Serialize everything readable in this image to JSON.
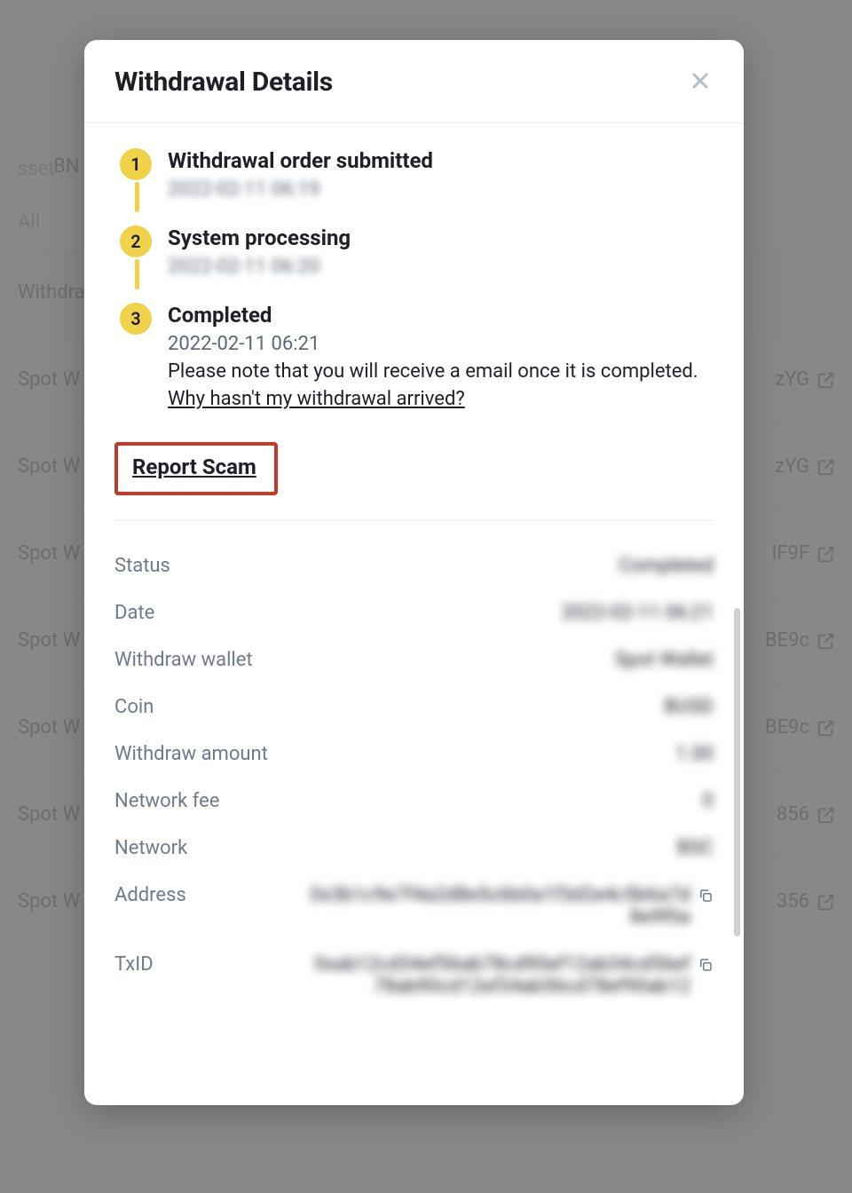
{
  "background": {
    "coin_hint": "BN",
    "column_header": "sset",
    "filter": "All",
    "row_heading": "Withdraw",
    "rows": [
      {
        "left": "Spot W",
        "right": "zYG"
      },
      {
        "left": "Spot W",
        "right": "zYG"
      },
      {
        "left": "Spot W",
        "right": "IF9F"
      },
      {
        "left": "Spot W",
        "right": "BE9c"
      },
      {
        "left": "Spot W",
        "right": "BE9c"
      },
      {
        "left": "Spot W",
        "right": "856"
      },
      {
        "left": "Spot W",
        "right": "356"
      }
    ]
  },
  "modal": {
    "title": "Withdrawal Details",
    "steps": [
      {
        "num": "1",
        "title": "Withdrawal order submitted",
        "time": "2022-02-11 06:19",
        "redacted": true
      },
      {
        "num": "2",
        "title": "System processing",
        "time": "2022-02-11 06:20",
        "redacted": true
      },
      {
        "num": "3",
        "title": "Completed",
        "time": "2022-02-11 06:21",
        "redacted": false
      }
    ],
    "completed_note": "Please note that you will receive a email once it is completed.",
    "faq_link": "Why hasn't my withdrawal arrived?",
    "report_scam": "Report Scam",
    "details": {
      "status": {
        "label": "Status",
        "value": "Completed"
      },
      "date": {
        "label": "Date",
        "value": "2022-02-11 06:21"
      },
      "withdraw_wallet": {
        "label": "Withdraw wallet",
        "value": "Spot Wallet"
      },
      "coin": {
        "label": "Coin",
        "value": "BUSD"
      },
      "withdraw_amount": {
        "label": "Withdraw amount",
        "value": "1.00"
      },
      "network_fee": {
        "label": "Network fee",
        "value": "0"
      },
      "network": {
        "label": "Network",
        "value": "BSC"
      },
      "address": {
        "label": "Address",
        "value": "0x3b1c9e7f4a2d8e5c6b0a1f3d2e4c5b6a7d8e9f0a"
      },
      "txid": {
        "label": "TxID",
        "value": "0xab12cd34ef56ab78cd90ef12ab34cd56ef78ab90cd12ef34ab56cd78ef90ab12"
      }
    }
  }
}
